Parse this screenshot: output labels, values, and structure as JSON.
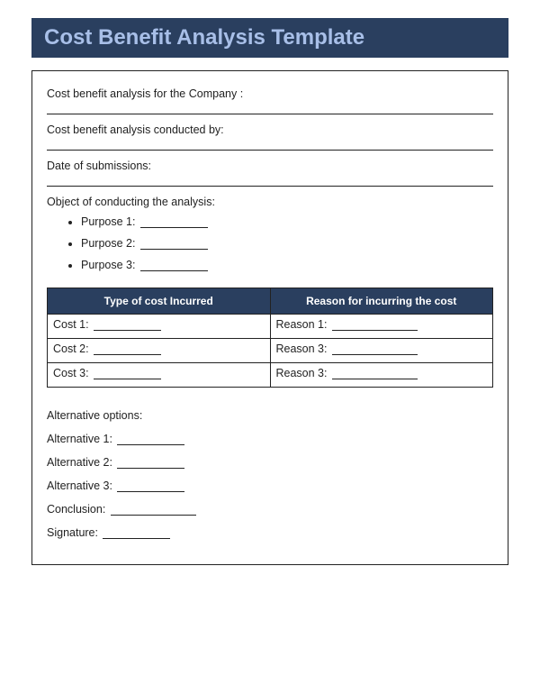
{
  "header": {
    "title": "Cost Benefit Analysis Template"
  },
  "fields": {
    "company_label": "Cost benefit analysis for the Company :",
    "conducted_by_label": "Cost benefit analysis conducted  by:",
    "date_label": "Date of submissions:",
    "object_label": "Object of conducting the analysis:"
  },
  "purposes": [
    {
      "label": "Purpose 1:"
    },
    {
      "label": "Purpose 2:"
    },
    {
      "label": "Purpose 3:"
    }
  ],
  "table": {
    "header_cost": "Type of cost Incurred",
    "header_reason": "Reason for incurring the cost",
    "rows": [
      {
        "cost": "Cost 1:",
        "reason": "Reason 1:"
      },
      {
        "cost": "Cost 2:",
        "reason": "Reason 3:"
      },
      {
        "cost": "Cost 3:",
        "reason": "Reason 3:"
      }
    ]
  },
  "bottom": {
    "alt_options_label": "Alternative options:",
    "alt1": "Alternative 1:",
    "alt2": "Alternative 2:",
    "alt3": "Alternative 3:",
    "conclusion": "Conclusion:",
    "signature": "Signature:"
  }
}
